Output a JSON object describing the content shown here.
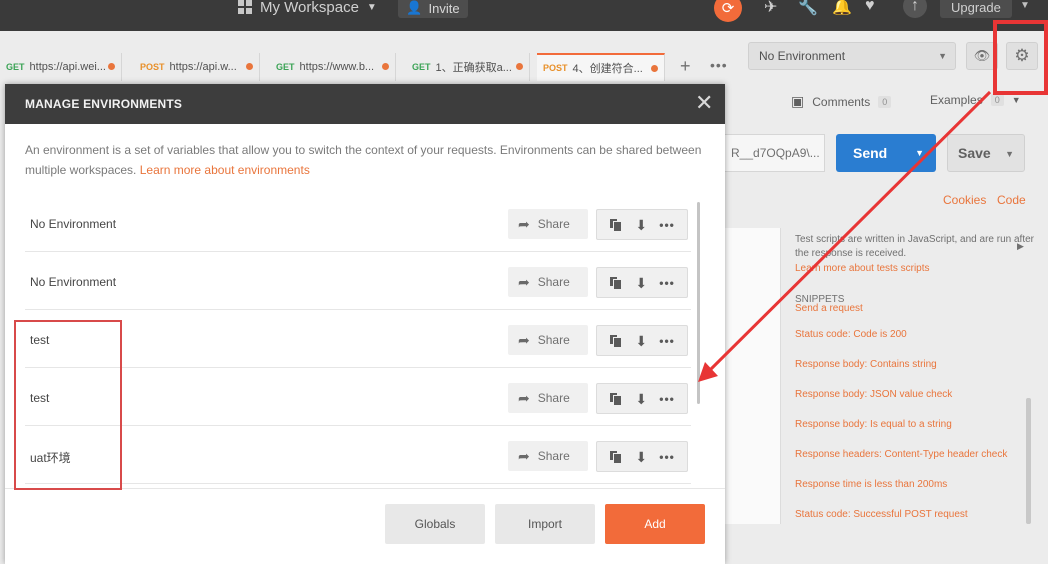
{
  "header": {
    "workspace": "My Workspace",
    "invite": "Invite",
    "upgrade": "Upgrade"
  },
  "tabs": [
    {
      "method": "GET",
      "label": "https://api.wei..."
    },
    {
      "method": "POST",
      "label": "https://api.w..."
    },
    {
      "method": "GET",
      "label": "https://www.b..."
    },
    {
      "method": "GET",
      "label": "1、正确获取a..."
    },
    {
      "method": "POST",
      "label": "4、创建符合..."
    }
  ],
  "env_select": {
    "value": "No Environment"
  },
  "right": {
    "comments": "Comments",
    "comments_count": "0",
    "examples": "Examples",
    "examples_count": "0",
    "url_tail": "R__d7OQpA9\\...",
    "send": "Send",
    "save": "Save",
    "cookies": "Cookies",
    "code": "Code",
    "tests_info": "Test scripts are written in JavaScript, and are run after the response is received.",
    "tests_link": "Learn more about tests scripts",
    "snippets_title": "SNIPPETS",
    "snippets": [
      "Send a request",
      "Status code: Code is 200",
      "Response body: Contains string",
      "Response body: JSON value check",
      "Response body: Is equal to a string",
      "Response headers: Content-Type header check",
      "Response time is less than 200ms",
      "Status code: Successful POST request"
    ]
  },
  "modal": {
    "title": "MANAGE ENVIRONMENTS",
    "description": "An environment is a set of variables that allow you to switch the context of your requests. Environments can be shared between multiple workspaces.",
    "learn_more": "Learn more about environments",
    "share_label": "Share",
    "environments": [
      "No Environment",
      "No Environment",
      "test",
      "test",
      "uat环境"
    ],
    "buttons": {
      "globals": "Globals",
      "import": "Import",
      "add": "Add"
    }
  },
  "colors": {
    "accent": "#f26b3a",
    "send_blue": "#2a7dd1",
    "annotation_red": "#e83535"
  }
}
